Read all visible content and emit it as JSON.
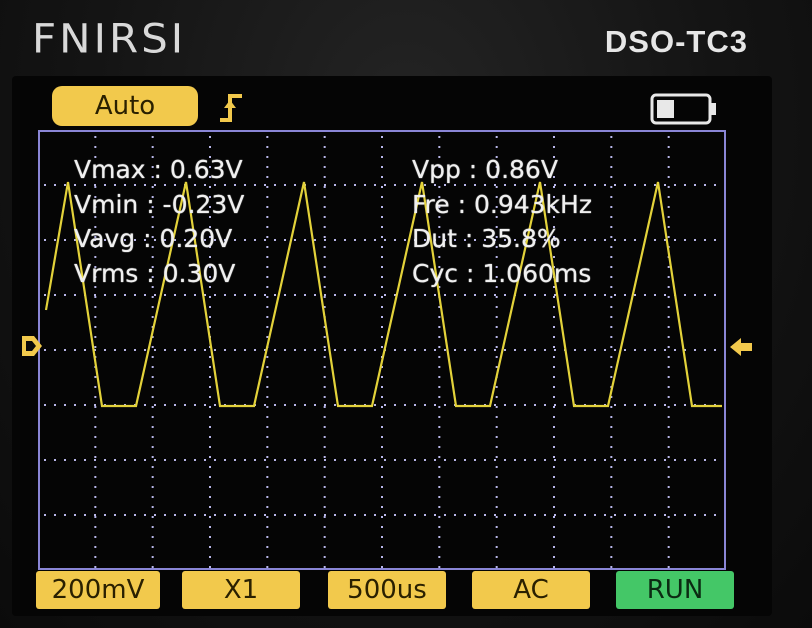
{
  "device": {
    "brand": "FNIRSI",
    "model": "DSO-TC3"
  },
  "status": {
    "mode": "Auto",
    "trigger_edge_icon": "rising-edge-icon",
    "battery_icon": "battery-icon",
    "battery_level": 0.35
  },
  "measurements": {
    "left": [
      "Vmax : 0.63V",
      "Vmin : -0.23V",
      "Vavg : 0.20V",
      "Vrms : 0.30V"
    ],
    "right": [
      "Vpp : 0.86V",
      "Fre : 0.943kHz",
      "Dut : 35.8%",
      "Cyc : 1.060ms"
    ]
  },
  "softkeys": {
    "volts_div": "200mV",
    "probe": "X1",
    "time_div": "500us",
    "coupling": "AC",
    "run_state": "RUN"
  },
  "colors": {
    "trace": "#e3d23a",
    "grid_border": "#8a86d6",
    "grid_dots": "#b8b6e8",
    "badge": "#f2c94c",
    "run": "#44c767"
  }
}
